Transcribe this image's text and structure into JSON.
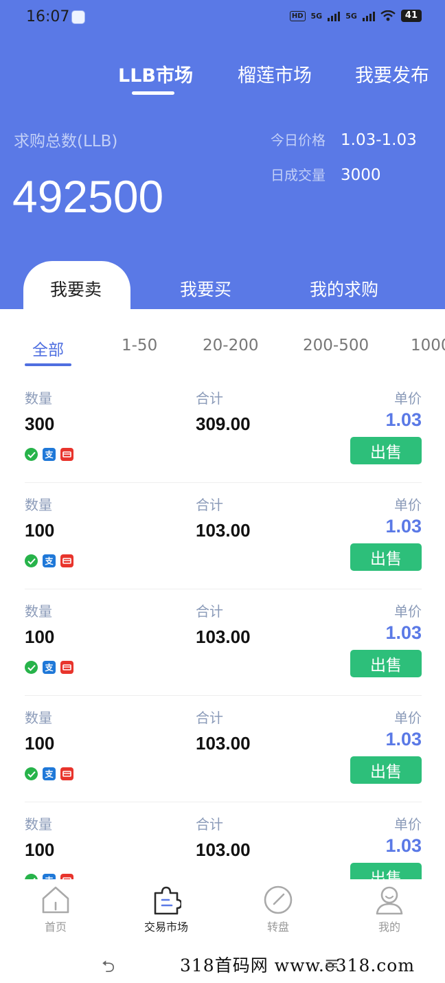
{
  "status": {
    "time": "16:07",
    "network1": "5G",
    "network2": "5G",
    "hd": "HD",
    "battery": "41"
  },
  "top_tabs": [
    {
      "label": "LLB市场",
      "active": true
    },
    {
      "label": "榴莲市场",
      "active": false
    },
    {
      "label": "我要发布",
      "active": false
    }
  ],
  "stats": {
    "total_label": "求购总数(LLB)",
    "total_value": "492500",
    "today_price_label": "今日价格",
    "today_price_value": "1.03-1.03",
    "daily_volume_label": "日成交量",
    "daily_volume_value": "3000"
  },
  "sub_tabs": [
    {
      "label": "我要卖",
      "active": true
    },
    {
      "label": "我要买",
      "active": false
    },
    {
      "label": "我的求购",
      "active": false
    }
  ],
  "filters": [
    {
      "label": "全部",
      "active": true
    },
    {
      "label": "1-50",
      "active": false
    },
    {
      "label": "20-200",
      "active": false
    },
    {
      "label": "200-500",
      "active": false
    },
    {
      "label": "1000",
      "active": false
    }
  ],
  "list_labels": {
    "quantity": "数量",
    "total": "合计",
    "unit_price": "单价",
    "sell": "出售"
  },
  "orders": [
    {
      "quantity": "300",
      "total": "309.00",
      "price": "1.03"
    },
    {
      "quantity": "100",
      "total": "103.00",
      "price": "1.03"
    },
    {
      "quantity": "100",
      "total": "103.00",
      "price": "1.03"
    },
    {
      "quantity": "100",
      "total": "103.00",
      "price": "1.03"
    },
    {
      "quantity": "100",
      "total": "103.00",
      "price": "1.03"
    }
  ],
  "payment_icons": [
    "wechat-pay-icon",
    "alipay-icon",
    "unionpay-icon"
  ],
  "alipay_glyph": "支",
  "bottom_nav": [
    {
      "label": "首页",
      "icon": "home-icon",
      "active": false
    },
    {
      "label": "交易市场",
      "icon": "market-icon",
      "active": true
    },
    {
      "label": "转盘",
      "icon": "compass-icon",
      "active": false
    },
    {
      "label": "我的",
      "icon": "user-icon",
      "active": false
    }
  ],
  "watermark": "318首码网  www.e318.com",
  "colors": {
    "header": "#5a79e6",
    "sell_button": "#2dbf7a",
    "price": "#5a79e6"
  }
}
